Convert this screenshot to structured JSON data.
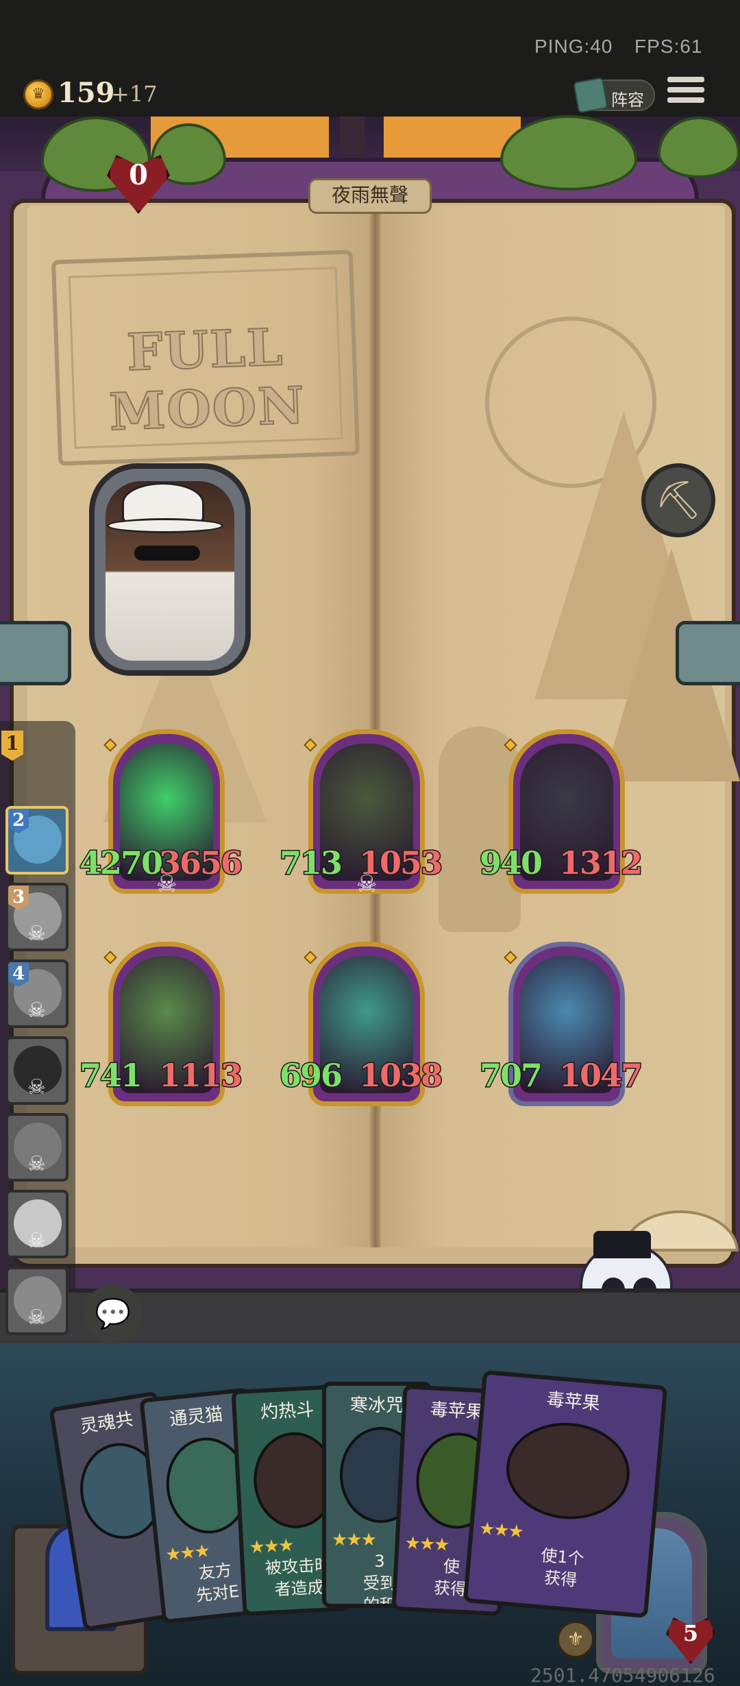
{
  "status": {
    "ping": "PING:40",
    "fps": "FPS:61"
  },
  "resources": {
    "coin_icon": "coin-icon",
    "gold": "159",
    "gold_income": "+17"
  },
  "header": {
    "lineup_label": "阵容",
    "menu_icon": "hamburger-menu-icon"
  },
  "encounter": {
    "name": "夜雨無聲"
  },
  "board": {
    "sign_text": "FULL MOON"
  },
  "enemy": {
    "health": "0"
  },
  "turn_order": {
    "current": "1",
    "slots": [
      {
        "num": "2",
        "active": true
      },
      {
        "num": "3",
        "active": false
      },
      {
        "num": "4",
        "active": false
      },
      {
        "num": "",
        "active": false
      },
      {
        "num": "",
        "active": false
      },
      {
        "num": "",
        "active": false
      },
      {
        "num": "",
        "active": false
      }
    ]
  },
  "units": [
    {
      "atk": "4270",
      "hp": "3656",
      "color": "#3fcf6a"
    },
    {
      "atk": "713",
      "hp": "1053",
      "color": "#4a5a3c"
    },
    {
      "atk": "940",
      "hp": "1312",
      "color": "#3a3a46"
    },
    {
      "atk": "741",
      "hp": "1113",
      "color": "#5a8a4a"
    },
    {
      "atk": "696",
      "hp": "1038",
      "color": "#3f9a8a"
    },
    {
      "atk": "707",
      "hp": "1047",
      "color": "#4a8ab0"
    }
  ],
  "hand": [
    {
      "title": "灵魂共",
      "desc": ""
    },
    {
      "title": "通灵猫",
      "desc": "友方\n先对E"
    },
    {
      "title": "灼热斗",
      "desc": "被攻击时\n者造成"
    },
    {
      "title": "寒冰咒",
      "desc": "3\n受到\n的积"
    },
    {
      "title": "毒苹果",
      "desc": "使\n获得"
    },
    {
      "title": "毒苹果",
      "desc": "使1个\n获得"
    }
  ],
  "player": {
    "health": "5"
  },
  "footer": {
    "seed": "2501.47054906126"
  },
  "colors": {
    "gold": "#c8952c",
    "atk": "#7ee06a",
    "hp": "#f06a6a",
    "page": "#d6bd91"
  }
}
